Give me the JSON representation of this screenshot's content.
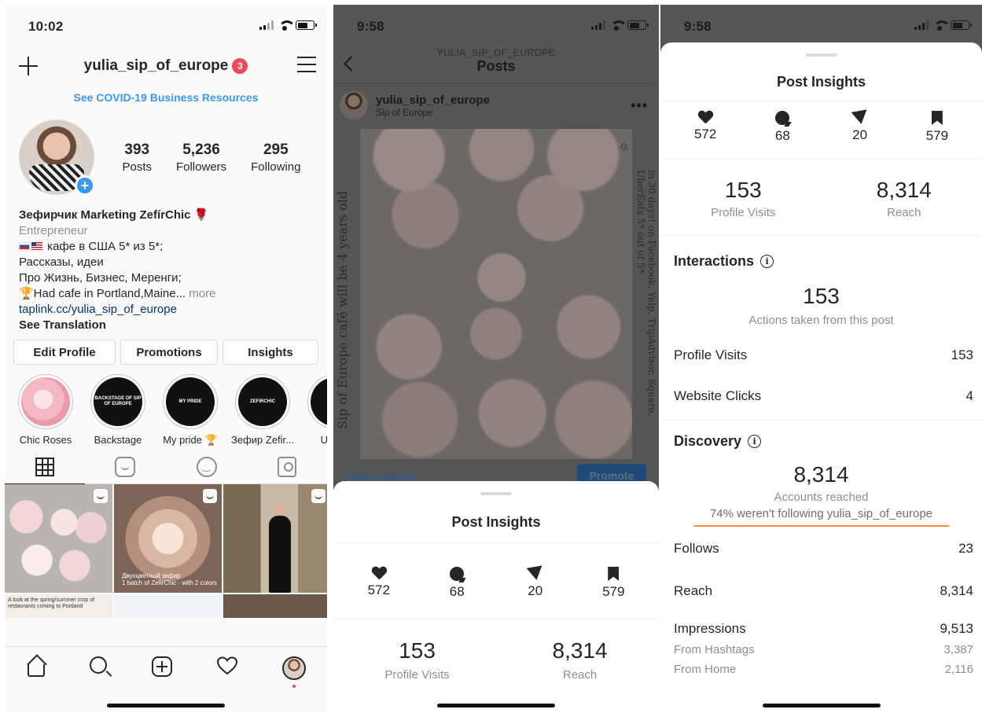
{
  "panel1": {
    "status": {
      "time": "10:02"
    },
    "nav": {
      "username": "yulia_sip_of_europe",
      "badge": "3"
    },
    "covid": "See COVID-19 Business Resources",
    "stats": [
      {
        "num": "393",
        "label": "Posts"
      },
      {
        "num": "5,236",
        "label": "Followers"
      },
      {
        "num": "295",
        "label": "Following"
      }
    ],
    "bio": {
      "name": "Зефирчик Marketing ZefírChic 🌹",
      "category": "Entrepreneur",
      "line1": "кафе в США 5* из 5*;",
      "line2": "Рассказы, идеи",
      "line3": "Про Жизнь, Бизнес, Меренги;",
      "line4": "🏆Had cafe in Portland,Maine...",
      "more": " more",
      "link": "taplink.cc/yulia_sip_of_europe",
      "translation": "See Translation"
    },
    "buttons": {
      "edit": "Edit Profile",
      "promotions": "Promotions",
      "insights": "Insights"
    },
    "highlights": [
      {
        "label": "Chic Roses",
        "inner": ""
      },
      {
        "label": "Backstage",
        "inner": "BACKSTAGE OF SIP OF EUROPE"
      },
      {
        "label": "My pride 🏆",
        "inner": "MY PRIDE"
      },
      {
        "label": "Зефир Zefir...",
        "inner": "ZEFIRCHIC"
      },
      {
        "label": "Useful",
        "inner": "U"
      }
    ],
    "grid": {
      "cap2_line1": "Двухцветный зефир",
      "cap2_line2": "1 batch of ZefirChic · with 2 colors",
      "cap4": "A look at the spring/summer crop of restaurants coming to Portland"
    }
  },
  "panel2": {
    "status": {
      "time": "9:58"
    },
    "header": {
      "sub": "YULIA_SIP_OF_EUROPE",
      "title": "Posts"
    },
    "post_user": {
      "name": "yulia_sip_of_europe",
      "subtitle": "Sip of Europe",
      "more": "•••"
    },
    "image_text_left": "Sip of Europe café will be 4 years old",
    "image_text_right": "in 30 days! on Facebook, Yelp, TripAdvisor, Square, UberEats 5* out of 5*",
    "timer": "0:",
    "view_insights": "View Insights",
    "promote": "Promote",
    "sheet": {
      "title": "Post Insights",
      "metrics": [
        {
          "icon": "heart-icon",
          "value": "572"
        },
        {
          "icon": "comment-icon",
          "value": "68"
        },
        {
          "icon": "send-icon",
          "value": "20"
        },
        {
          "icon": "bookmark-icon",
          "value": "579"
        }
      ],
      "profile_visits": "153",
      "profile_visits_label": "Profile Visits",
      "reach": "8,314",
      "reach_label": "Reach"
    }
  },
  "panel3": {
    "status": {
      "time": "9:58"
    },
    "sheet": {
      "title": "Post Insights",
      "metrics": [
        {
          "icon": "heart-icon",
          "value": "572"
        },
        {
          "icon": "comment-icon",
          "value": "68"
        },
        {
          "icon": "send-icon",
          "value": "20"
        },
        {
          "icon": "bookmark-icon",
          "value": "579"
        }
      ],
      "profile_visits": "153",
      "profile_visits_label": "Profile Visits",
      "reach": "8,314",
      "reach_label": "Reach",
      "interactions": {
        "title": "Interactions",
        "value": "153",
        "caption": "Actions taken from this post",
        "rows": [
          {
            "label": "Profile Visits",
            "value": "153"
          },
          {
            "label": "Website Clicks",
            "value": "4"
          }
        ]
      },
      "discovery": {
        "title": "Discovery",
        "value": "8,314",
        "caption": "Accounts reached",
        "note": "74% weren't following yulia_sip_of_europe",
        "rows": [
          {
            "label": "Follows",
            "value": "23"
          },
          {
            "label": "Reach",
            "value": "8,314"
          },
          {
            "label": "Impressions",
            "value": "9,513"
          }
        ],
        "subrows": [
          {
            "label": "From Hashtags",
            "value": "3,387"
          },
          {
            "label": "From Home",
            "value": "2,116"
          }
        ]
      }
    }
  },
  "colors": {
    "accent_blue": "#3897f0",
    "badge_red": "#ed4956",
    "orange_line": "#f08c32",
    "muted": "#8e8e8e"
  }
}
